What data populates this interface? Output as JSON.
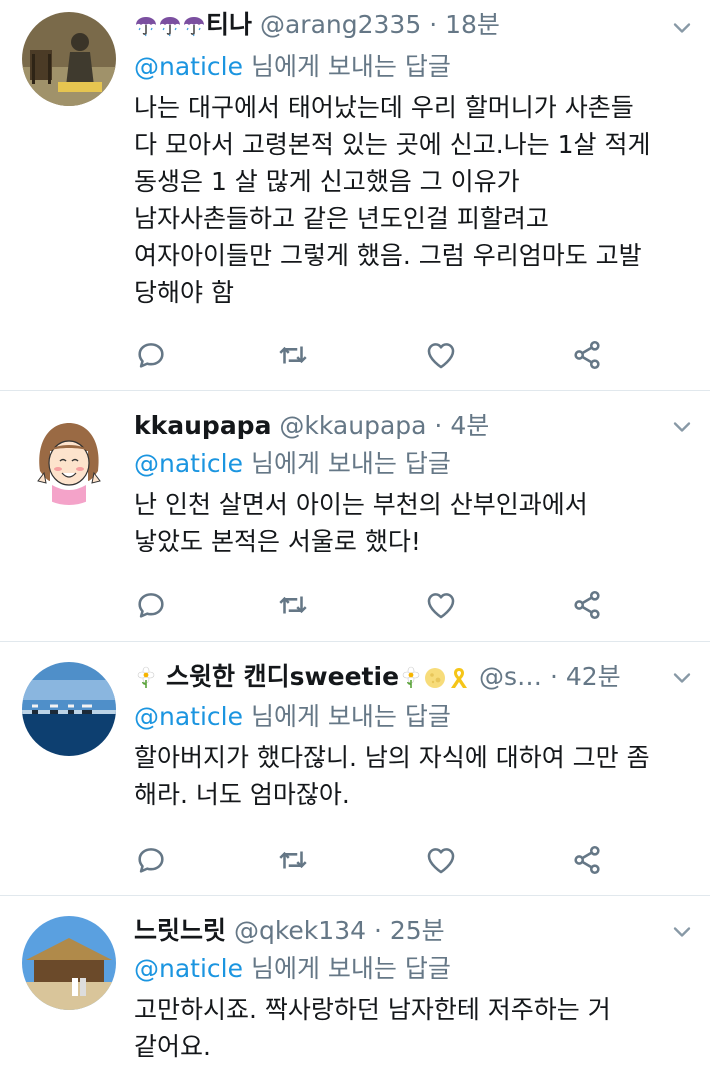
{
  "tweets": [
    {
      "name": "티나",
      "name_prefix_icons": [
        "umbrella-icon",
        "umbrella-icon",
        "umbrella-icon"
      ],
      "handle": "@arang2335",
      "time": "18분",
      "reply_label": "님에게 보내는 답글",
      "reply_mention": "@naticle",
      "lines": [
        "나는 대구에서 태어났는데 우리 할머니가 사촌들",
        "다 모아서 고령본적 있는 곳에 신고.나는 1살 적게",
        "동생은 1 살 많게 신고했음 그 이유가",
        "남자사촌들하고 같은 년도인걸 피할려고",
        "여자아이들만 그렇게 했음. 그럼 우리엄마도 고발",
        "당해야 함"
      ]
    },
    {
      "name": "kkaupapa",
      "handle": "@kkaupapa",
      "time": "4분",
      "reply_label": "님에게 보내는 답글",
      "reply_mention": "@naticle",
      "lines": [
        "난 인천 살면서 아이는 부천의 산부인과에서",
        "낳았도 본적은 서울로 했다!"
      ]
    },
    {
      "name": "스윗한 캔디sweetie",
      "name_prefix_icons": [
        "flower-icon"
      ],
      "name_suffix_icons": [
        "flower-icon",
        "moon-icon",
        "yellow-ribbon-icon"
      ],
      "handle": "@s…",
      "time": "42분",
      "reply_label": "님에게 보내는 답글",
      "reply_mention": "@naticle",
      "lines": [
        "할아버지가 했다잖니. 남의 자식에 대하여 그만 좀",
        "해라. 너도 엄마잖아."
      ]
    },
    {
      "name": "느릿느릿",
      "handle": "@qkek134",
      "time": "25분",
      "reply_label": "님에게 보내는 답글",
      "reply_mention": "@naticle",
      "lines": [
        "고만하시죠. 짝사랑하던 남자한테 저주하는 거",
        "같어요."
      ]
    }
  ],
  "dot": "·",
  "colors": {
    "link": "#1b95e0",
    "secondary": "#657786",
    "divider": "#e1e8ed",
    "ribbon": "#f5c518"
  },
  "actions": [
    "reply-icon",
    "retweet-icon",
    "like-icon",
    "share-icon"
  ]
}
